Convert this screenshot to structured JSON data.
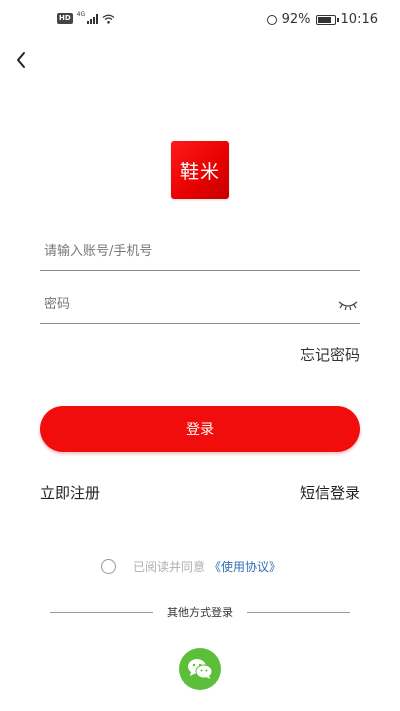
{
  "statusbar": {
    "hd": "HD",
    "network": "4G",
    "battery_percent": "92%",
    "time": "10:16",
    "icons": [
      "hd-icon",
      "signal-icon",
      "wifi-icon",
      "alarm-icon",
      "battery-icon"
    ]
  },
  "nav": {
    "back_icon": "chevron-left-icon"
  },
  "logo": {
    "text": "鞋米",
    "color": "#e60000"
  },
  "form": {
    "account_placeholder": "请输入账号/手机号",
    "account_value": "",
    "password_placeholder": "密码",
    "password_value": "",
    "password_toggle_icon": "eye-closed-icon"
  },
  "links": {
    "forgot": "忘记密码",
    "register": "立即注册",
    "sms_login": "短信登录"
  },
  "login_button": {
    "label": "登录",
    "color": "#f20d0d"
  },
  "agreement": {
    "checked": false,
    "text": "已阅读并同意",
    "link": "《使用协议》"
  },
  "other_login": {
    "label": "其他方式登录",
    "wechat_icon": "wechat-icon",
    "wechat_color": "#5bbf3a"
  }
}
